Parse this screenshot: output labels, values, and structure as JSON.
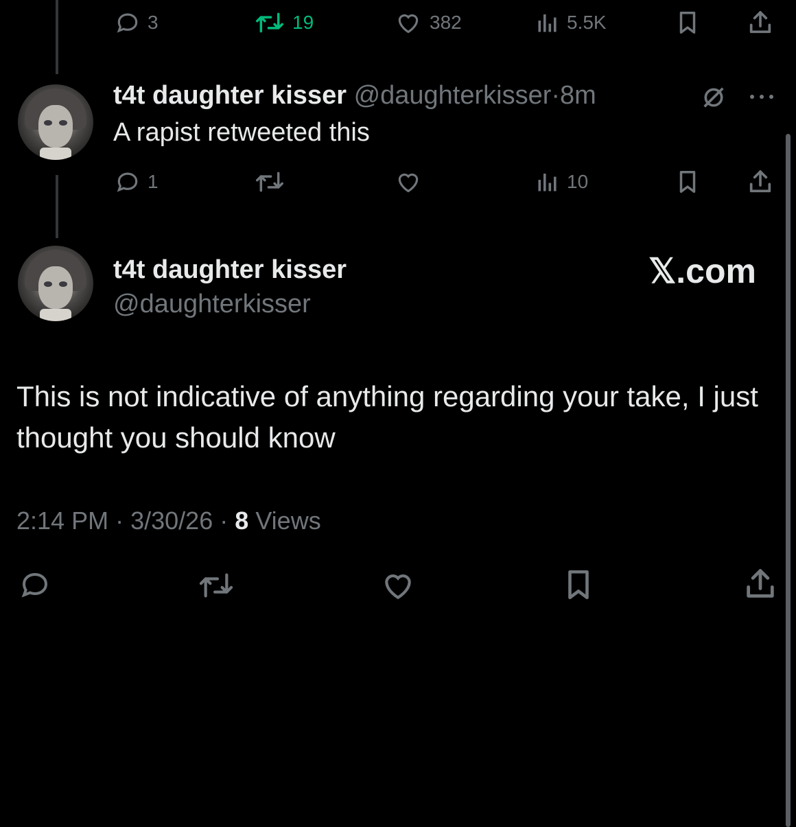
{
  "top_actions": {
    "replies": "3",
    "retweets": "19",
    "likes": "382",
    "views": "5.5K"
  },
  "reply": {
    "name": "t4t daughter kisser",
    "handle": "@daughterkisser",
    "separator": "·",
    "time": "8m",
    "text": "A rapist retweeted this",
    "replies": "1",
    "views": "10"
  },
  "main_tweet": {
    "name": "t4t daughter kisser",
    "handle": "@daughterkisser",
    "watermark": "𝕏.com",
    "text": "This is not indicative of anything regarding your take, I just thought you should know",
    "time": "2:14 PM",
    "date": "3/30/26",
    "separator": "·",
    "views_count": "8",
    "views_label": "Views"
  },
  "colors": {
    "background": "#000000",
    "text": "#e7e9ea",
    "muted": "#71767b",
    "retweet_active": "#00ba7c"
  }
}
